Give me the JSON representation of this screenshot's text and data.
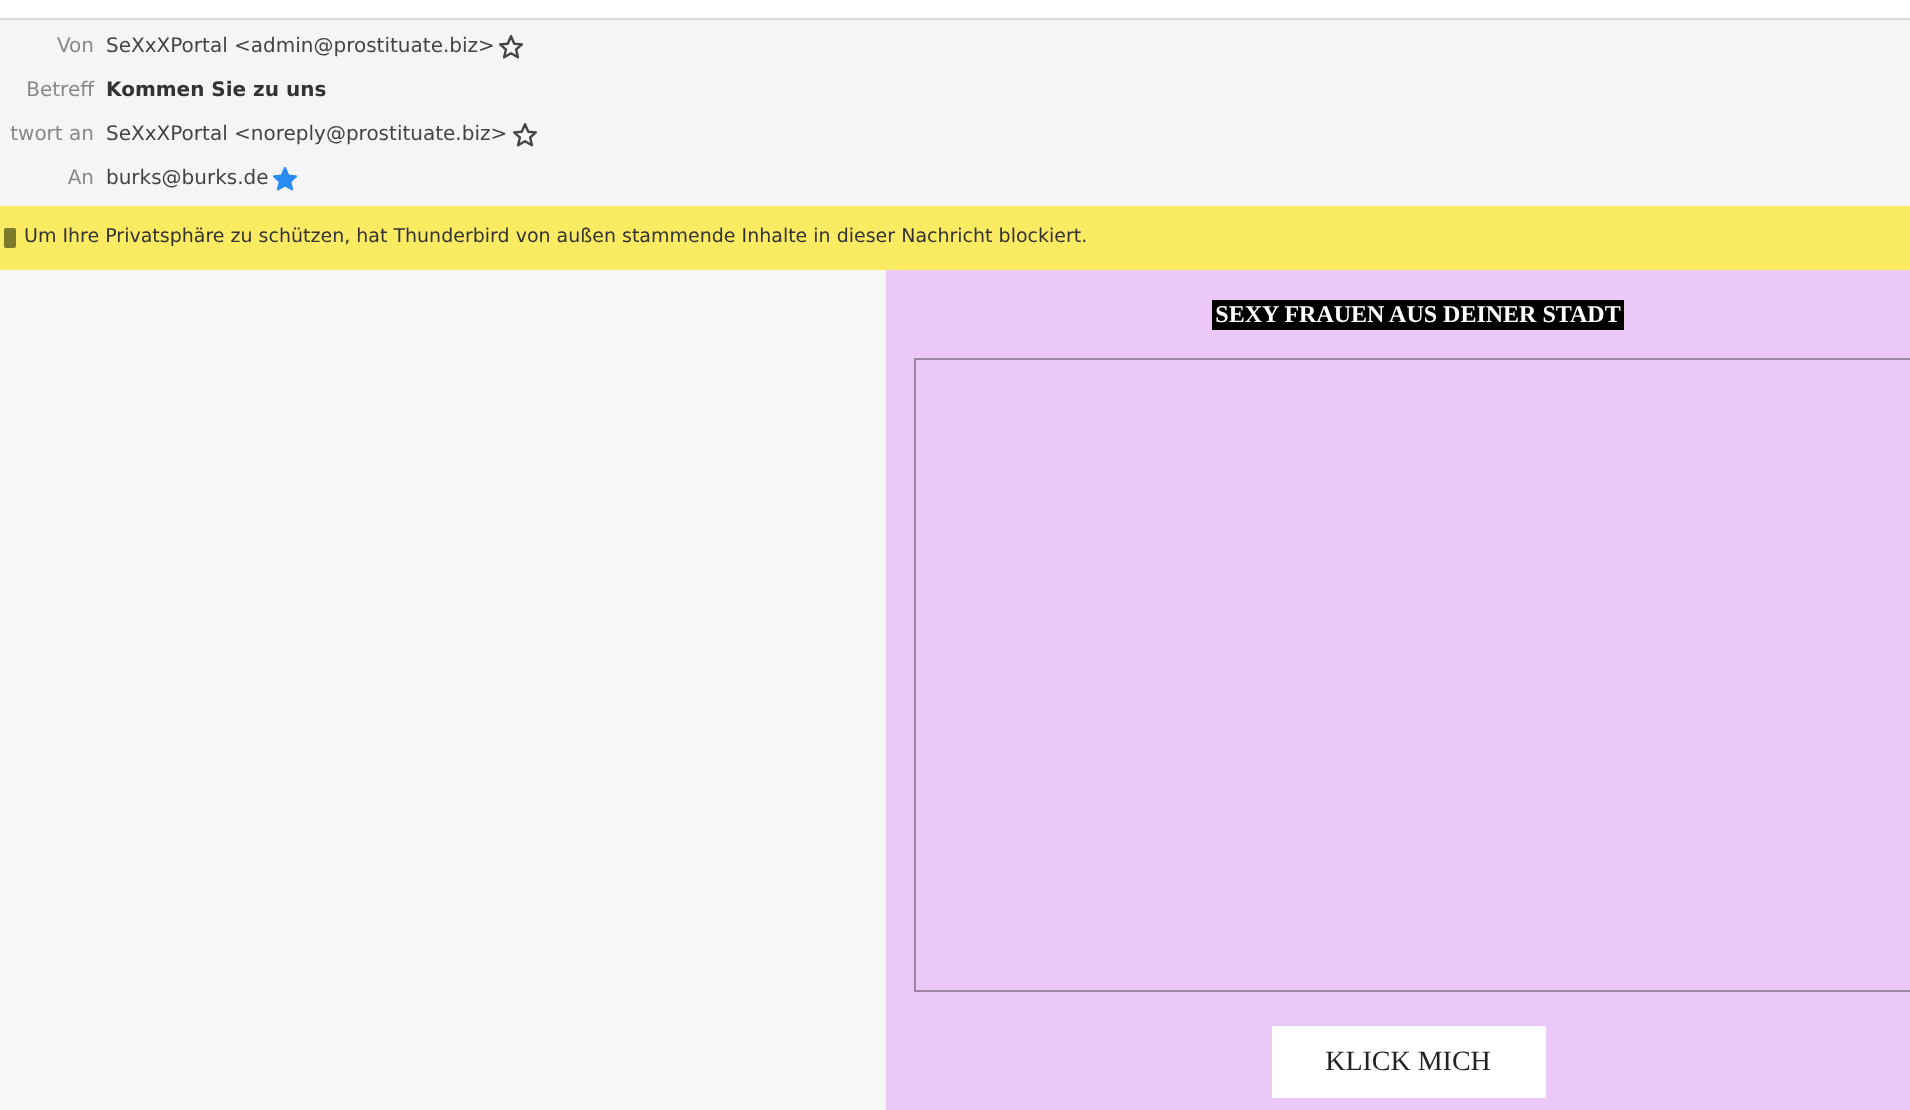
{
  "header": {
    "fields": [
      {
        "label": "Von",
        "value": "SeXxXPortal <admin@prostituate.biz>",
        "kind": "address",
        "starred": false
      },
      {
        "label": "Betreff",
        "value": "Kommen Sie zu uns",
        "kind": "subject"
      },
      {
        "label": "twort an",
        "value": "SeXxXPortal <noreply@prostituate.biz>",
        "kind": "address",
        "starred": false
      },
      {
        "label": "An",
        "value": "burks@burks.de",
        "kind": "address",
        "starred": true
      }
    ]
  },
  "notification": {
    "text": "Um Ihre Privatsphäre zu schützen, hat Thunderbird von außen stammende Inhalte in dieser Nachricht blockiert."
  },
  "message": {
    "heading": "SEXY FRAUEN AUS DEINER STADT",
    "button": "KLICK MICH"
  }
}
